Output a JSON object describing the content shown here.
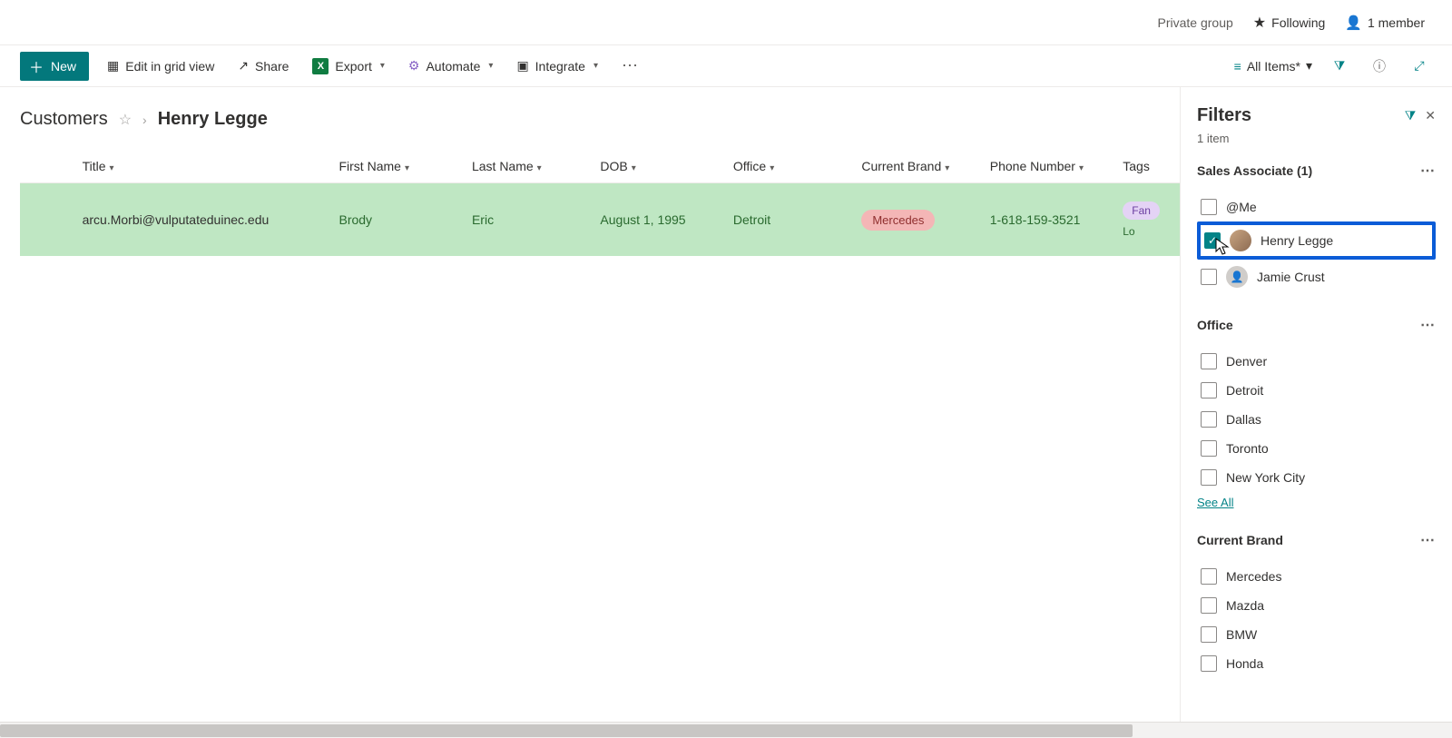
{
  "topbar": {
    "group_type": "Private group",
    "following": "Following",
    "members": "1 member"
  },
  "cmd": {
    "new": "New",
    "edit_grid": "Edit in grid view",
    "share": "Share",
    "export": "Export",
    "automate": "Automate",
    "integrate": "Integrate",
    "view_selected": "All Items*"
  },
  "breadcrumb": {
    "list": "Customers",
    "current_filter": "Henry Legge"
  },
  "columns": [
    "Title",
    "First Name",
    "Last Name",
    "DOB",
    "Office",
    "Current Brand",
    "Phone Number",
    "Tags"
  ],
  "row": {
    "title": "arcu.Morbi@vulputateduinec.edu",
    "first_name": "Brody",
    "last_name": "Eric",
    "dob": "August 1, 1995",
    "office": "Detroit",
    "brand": "Mercedes",
    "phone": "1-618-159-3521",
    "tag1": "Fan",
    "tag2": "Lo"
  },
  "filters": {
    "title": "Filters",
    "count": "1 item",
    "sections": {
      "sales_assoc": {
        "label": "Sales Associate (1)",
        "options": [
          {
            "label": "@Me",
            "checked": false,
            "avatar": false
          },
          {
            "label": "Henry Legge",
            "checked": true,
            "avatar": true,
            "highlighted": true
          },
          {
            "label": "Jamie Crust",
            "checked": false,
            "avatar": true
          }
        ]
      },
      "office": {
        "label": "Office",
        "options": [
          {
            "label": "Denver"
          },
          {
            "label": "Detroit"
          },
          {
            "label": "Dallas"
          },
          {
            "label": "Toronto"
          },
          {
            "label": "New York City"
          }
        ],
        "see_all": "See All"
      },
      "brand": {
        "label": "Current Brand",
        "options": [
          {
            "label": "Mercedes"
          },
          {
            "label": "Mazda"
          },
          {
            "label": "BMW"
          },
          {
            "label": "Honda"
          }
        ]
      }
    }
  }
}
